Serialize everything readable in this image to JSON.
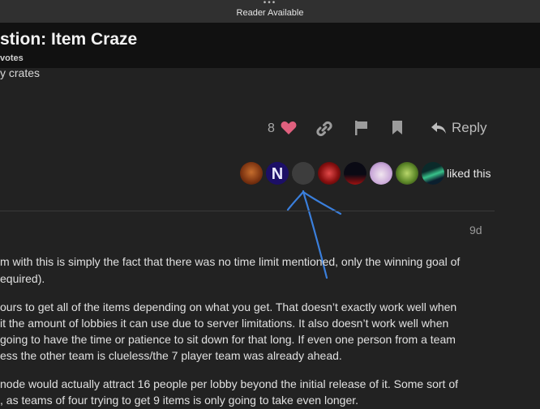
{
  "browser": {
    "more_glyph": "•••",
    "reader_label": "Reader Available"
  },
  "topic": {
    "title": "stion: Item Craze",
    "votes_label": "votes",
    "body_fragment": "y crates"
  },
  "post_actions": {
    "like_count": "8",
    "reply_label": "Reply"
  },
  "likes": {
    "liked_text": "liked this"
  },
  "reply_post": {
    "time_ago": "9d",
    "lines": [
      "m with this is simply the fact that there was no time limit mentioned, only the winning goal of",
      "equired).",
      "ours to get all of the items depending on what you get. That doesn’t exactly work well when",
      "it the amount of lobbies it can use due to server limitations. It also doesn’t work well when",
      "going to have the time or patience to sit down for that long. If even one person from a team",
      "ess the other team is clueless/the 7 player team was already ahead.",
      "node would actually attract 16 people per lobby beyond the initial release of it. Some sort of",
      ", as teams of four trying to get 9 items is only going to take even longer."
    ]
  },
  "colors": {
    "heart": "#e0607e",
    "annotation_arrow": "#3a7fdc",
    "background": "#222222",
    "header_band": "#111111"
  }
}
